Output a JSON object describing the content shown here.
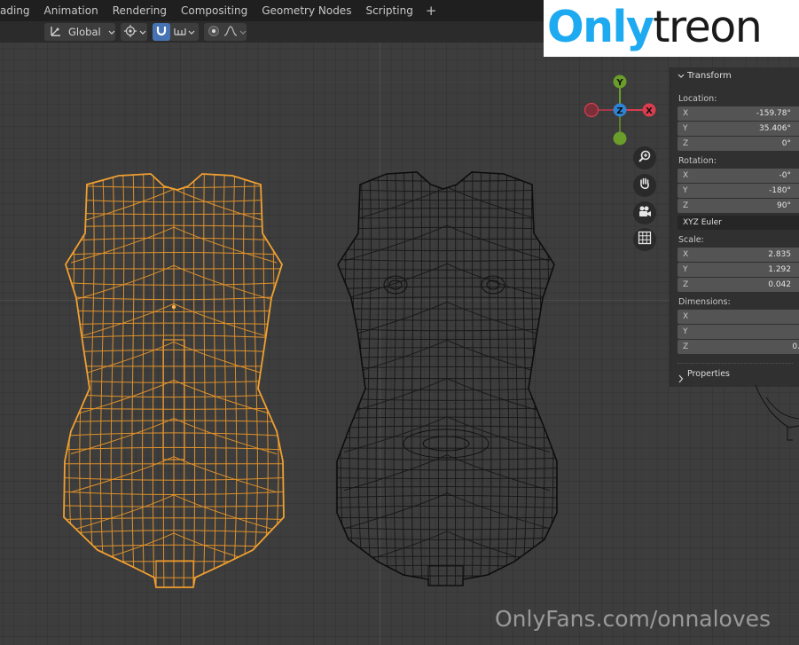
{
  "menubar": {
    "tabs": [
      "ading",
      "Animation",
      "Rendering",
      "Compositing",
      "Geometry Nodes",
      "Scripting"
    ],
    "add_tab_glyph": "+"
  },
  "toolbar": {
    "orientation_value": "Global",
    "orientation_icon": "transform-orientation-icon",
    "pivot_icon": "pivot-point-icon",
    "snap_icon": "snap-magnet-icon",
    "snap_target_icon": "snap-increment-icon",
    "proportional_icon": "proportional-edit-icon",
    "falloff_icon": "falloff-curve-icon"
  },
  "gizmo": {
    "axes": [
      {
        "label": "Y",
        "color": "#6a9d2a"
      },
      {
        "label": "Z",
        "color": "#2f83d4"
      },
      {
        "label": "X",
        "color": "#d93d4f"
      }
    ]
  },
  "nav_buttons": [
    "zoom-icon",
    "hand-pan-icon",
    "camera-icon",
    "grid-ortho-icon"
  ],
  "transform_panel": {
    "title": "Transform",
    "location_label": "Location:",
    "location": [
      {
        "axis": "X",
        "value": "-159.78°"
      },
      {
        "axis": "Y",
        "value": "35.406°"
      },
      {
        "axis": "Z",
        "value": "0°"
      }
    ],
    "rotation_label": "Rotation:",
    "rotation": [
      {
        "axis": "X",
        "value": "-0°"
      },
      {
        "axis": "Y",
        "value": "-180°"
      },
      {
        "axis": "Z",
        "value": "90°"
      }
    ],
    "rotation_mode": "XYZ Euler",
    "scale_label": "Scale:",
    "scale": [
      {
        "axis": "X",
        "value": "2.835"
      },
      {
        "axis": "Y",
        "value": "1.292"
      },
      {
        "axis": "Z",
        "value": "0.042"
      }
    ],
    "dimensions_label": "Dimensions:",
    "dimensions": [
      {
        "axis": "X",
        "value": ""
      },
      {
        "axis": "Y",
        "value": ""
      },
      {
        "axis": "Z",
        "value": "0."
      }
    ],
    "properties_label": "Properties"
  },
  "colors": {
    "selected_mesh": "#e8962a",
    "unselected_mesh": "#111111",
    "active_button": "#4772b3"
  },
  "watermark": {
    "logo_part1": "Only",
    "logo_part2": "treon",
    "bottom_text": "OnlyFans.com/onnaloves"
  }
}
